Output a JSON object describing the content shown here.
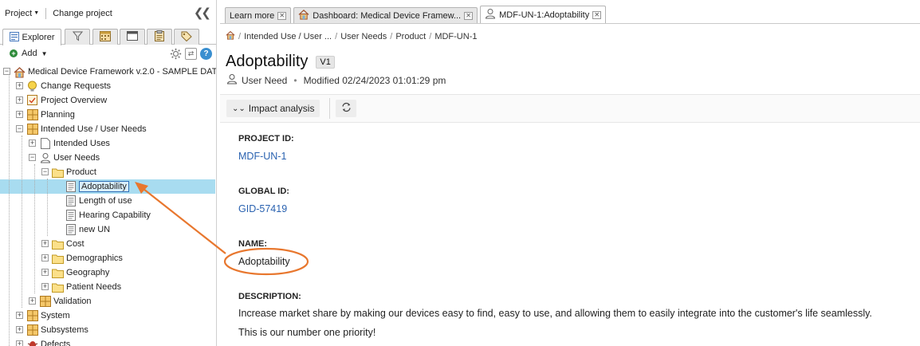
{
  "left": {
    "project_label": "Project",
    "change_project": "Change project",
    "explorer_tab": "Explorer",
    "add_label": "Add",
    "tree": [
      {
        "label": "Medical Device Framework v.2.0 - SAMPLE DAT",
        "icon": "project-icon"
      },
      {
        "label": "Change Requests",
        "icon": "bulb-icon"
      },
      {
        "label": "Project Overview",
        "icon": "overview-icon"
      },
      {
        "label": "Planning",
        "icon": "grid-icon"
      },
      {
        "label": "Intended Use / User Needs",
        "icon": "grid-icon"
      },
      {
        "label": "Intended Uses",
        "icon": "document-icon"
      },
      {
        "label": "User Needs",
        "icon": "user-icon"
      },
      {
        "label": "Product",
        "icon": "folder-icon"
      },
      {
        "label": "Adoptability",
        "icon": "doc-lines-icon"
      },
      {
        "label": "Length of use",
        "icon": "doc-lines-icon"
      },
      {
        "label": "Hearing Capability",
        "icon": "doc-lines-icon"
      },
      {
        "label": "new UN",
        "icon": "doc-lines-icon"
      },
      {
        "label": "Cost",
        "icon": "folder-icon"
      },
      {
        "label": "Demographics",
        "icon": "folder-icon"
      },
      {
        "label": "Geography",
        "icon": "folder-icon"
      },
      {
        "label": "Patient Needs",
        "icon": "folder-icon"
      },
      {
        "label": "Validation",
        "icon": "grid-icon"
      },
      {
        "label": "System",
        "icon": "grid-icon"
      },
      {
        "label": "Subsystems",
        "icon": "grid-icon"
      },
      {
        "label": "Defects",
        "icon": "bug-icon"
      }
    ]
  },
  "tabs": [
    {
      "label": "Learn more"
    },
    {
      "label": "Dashboard: Medical Device Framew..."
    },
    {
      "label": "MDF-UN-1:Adoptability"
    }
  ],
  "breadcrumb": [
    "Intended Use / User ...",
    "User Needs",
    "Product",
    "MDF-UN-1"
  ],
  "item": {
    "title": "Adoptability",
    "version": "V1",
    "type": "User Need",
    "modified": "Modified 02/24/2023 01:01:29 pm"
  },
  "toolbar": {
    "impact_analysis": "Impact analysis"
  },
  "fields": {
    "project_id_label": "PROJECT ID:",
    "project_id": "MDF-UN-1",
    "global_id_label": "GLOBAL ID:",
    "global_id": "GID-57419",
    "name_label": "NAME:",
    "name": "Adoptability",
    "description_label": "DESCRIPTION:",
    "description_1": "Increase market share by making our devices easy to find, easy to use, and allowing them to easily integrate into the customer's life seamlessly.",
    "description_2": "This is our number one priority!"
  },
  "colors": {
    "selection": "#a8dcf0",
    "link": "#2a62b0",
    "annotation": "#e8772e"
  }
}
